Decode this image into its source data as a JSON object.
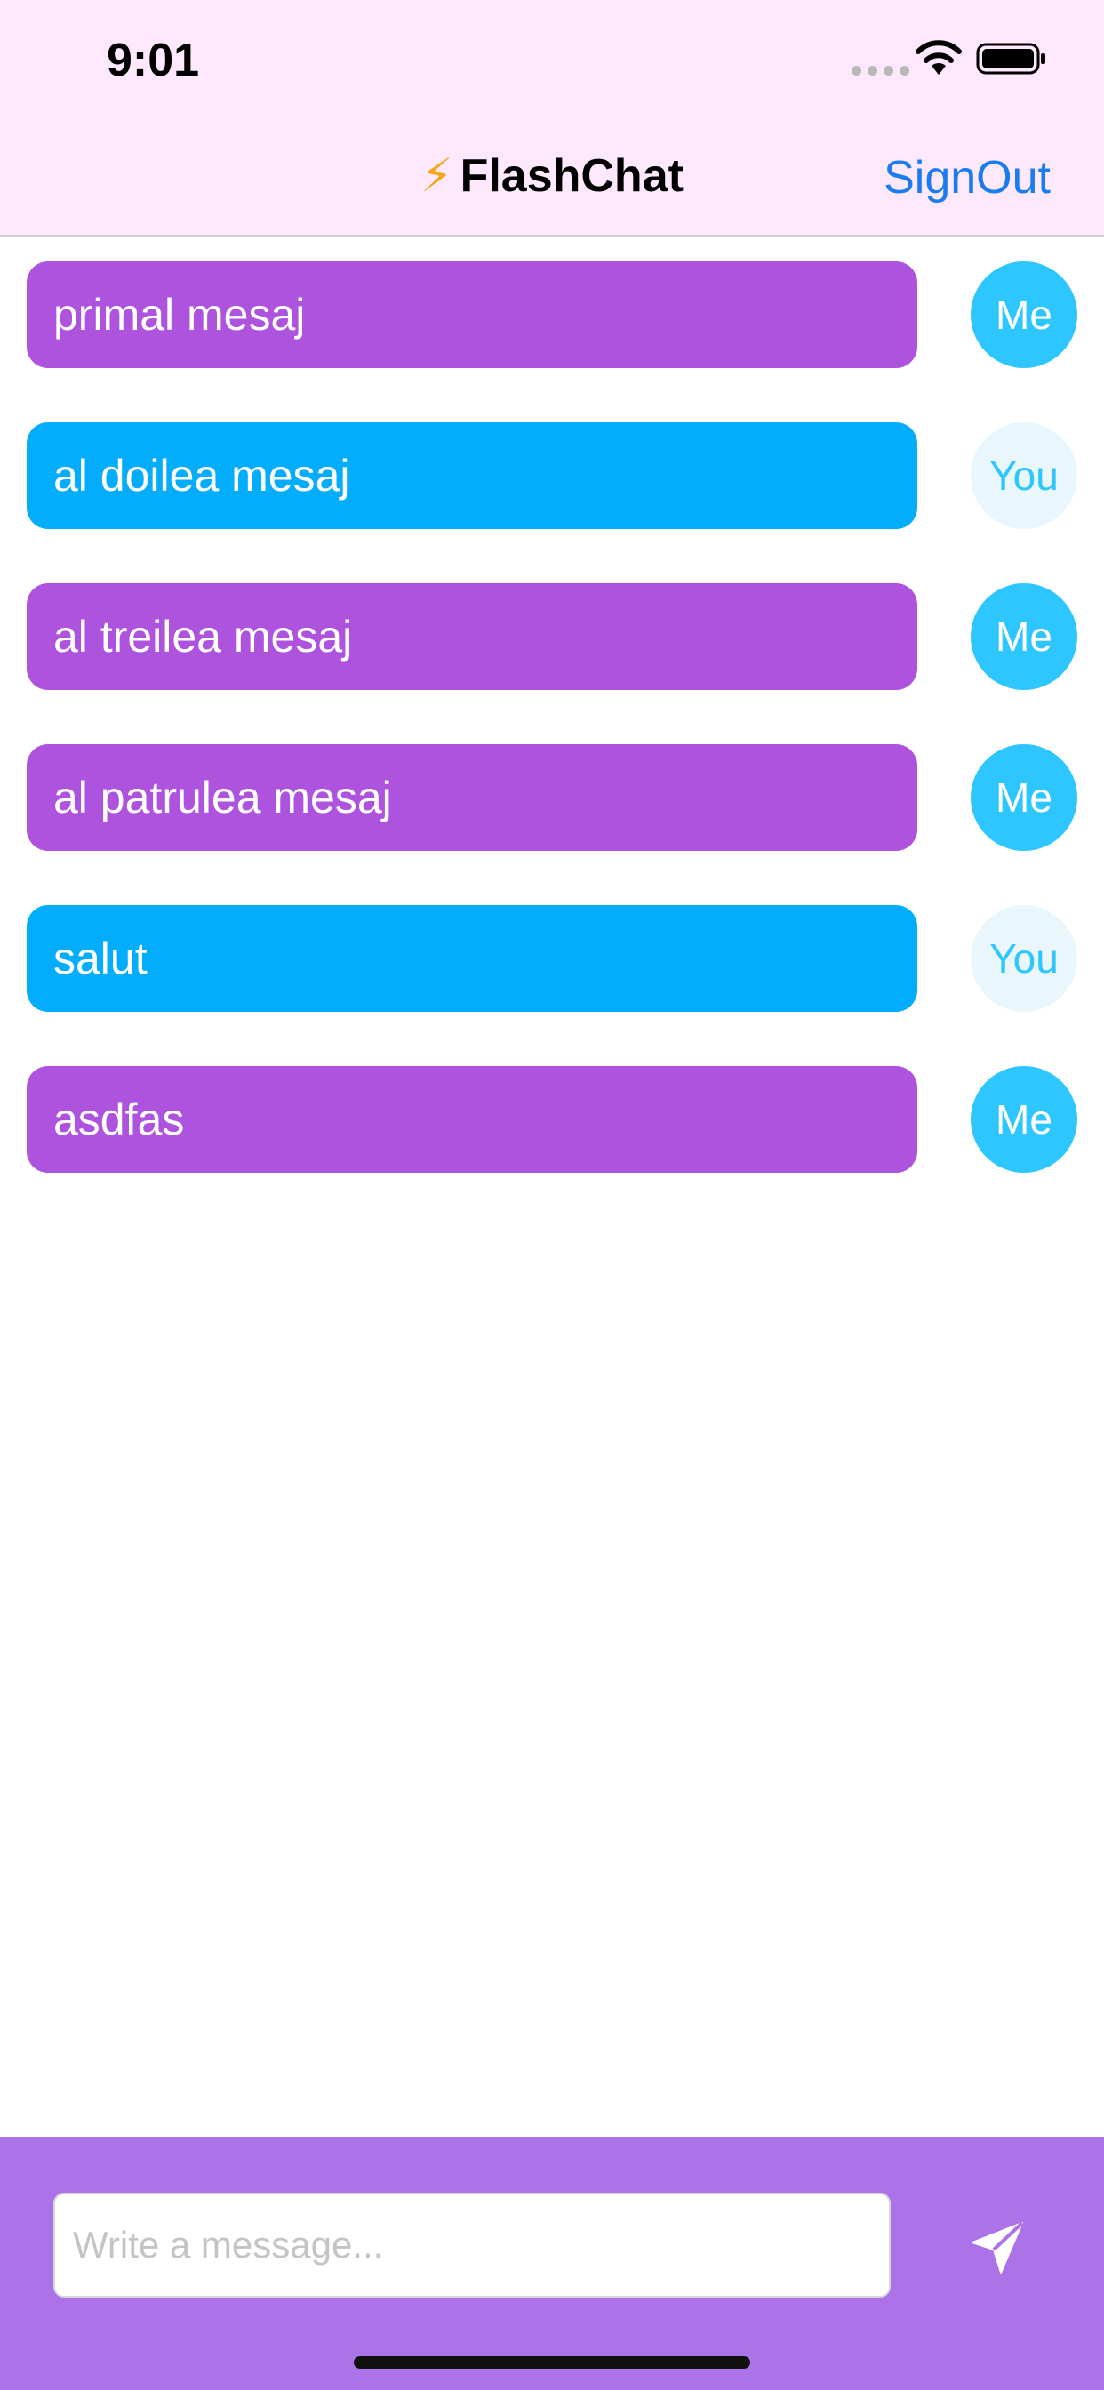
{
  "status_bar": {
    "time": "9:01"
  },
  "nav": {
    "bolt": "⚡",
    "title": "FlashChat",
    "signout_label": "SignOut"
  },
  "messages": [
    {
      "text": "primal mesaj",
      "sender": "Me"
    },
    {
      "text": "al doilea mesaj",
      "sender": "You"
    },
    {
      "text": "al treilea mesaj",
      "sender": "Me"
    },
    {
      "text": "al patrulea mesaj",
      "sender": "Me"
    },
    {
      "text": "salut",
      "sender": "You"
    },
    {
      "text": "asdfas",
      "sender": "Me"
    }
  ],
  "composer": {
    "placeholder": "Write a message..."
  },
  "icons": {
    "send": "paper-plane-icon",
    "wifi": "wifi-icon",
    "battery": "battery-icon"
  },
  "colors": {
    "bar_background": "#fde9fb",
    "me_bubble": "#ad53de",
    "you_bubble": "#04adfc",
    "avatar_me": "#2ec6ff",
    "avatar_you": "#e9f7fd",
    "composer_background": "#ac72e8",
    "link": "#1a7cf0"
  }
}
